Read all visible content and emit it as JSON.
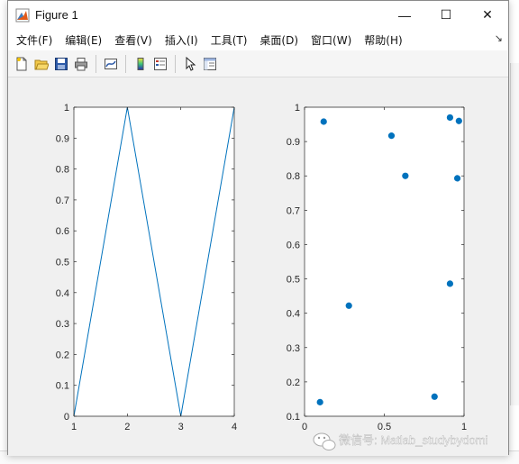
{
  "window": {
    "title": "Figure 1",
    "minimize_glyph": "—",
    "maximize_glyph": "☐",
    "close_glyph": "✕"
  },
  "menu": {
    "items": [
      {
        "label": "文件(F)"
      },
      {
        "label": "编辑(E)"
      },
      {
        "label": "查看(V)"
      },
      {
        "label": "插入(I)"
      },
      {
        "label": "工具(T)"
      },
      {
        "label": "桌面(D)"
      },
      {
        "label": "窗口(W)"
      },
      {
        "label": "帮助(H)"
      }
    ],
    "dock_glyph": "↘"
  },
  "toolbar": {
    "icons": [
      "new-figure-icon",
      "open-folder-icon",
      "save-icon",
      "print-icon",
      "link-plot-icon",
      "colorbar-icon",
      "legend-icon",
      "pointer-icon",
      "property-inspector-icon"
    ]
  },
  "watermark": {
    "text": "微信号: Matlab_studybydomi"
  },
  "chart_data": [
    {
      "type": "line",
      "x": [
        1,
        2,
        3,
        4
      ],
      "series": [
        {
          "values": [
            0,
            1,
            0,
            1
          ]
        }
      ],
      "xlim": [
        1,
        4
      ],
      "ylim": [
        0,
        1
      ],
      "xticks": [
        "1",
        "2",
        "3",
        "4"
      ],
      "yticks": [
        "0",
        "0.1",
        "0.2",
        "0.3",
        "0.4",
        "0.5",
        "0.6",
        "0.7",
        "0.8",
        "0.9",
        "1"
      ],
      "color": "#0072bd",
      "grid": false
    },
    {
      "type": "scatter",
      "points": [
        {
          "x": 0.12,
          "y": 0.958
        },
        {
          "x": 0.545,
          "y": 0.917
        },
        {
          "x": 0.912,
          "y": 0.97
        },
        {
          "x": 0.968,
          "y": 0.96
        },
        {
          "x": 0.632,
          "y": 0.8
        },
        {
          "x": 0.958,
          "y": 0.793
        },
        {
          "x": 0.912,
          "y": 0.486
        },
        {
          "x": 0.278,
          "y": 0.422
        },
        {
          "x": 0.097,
          "y": 0.141
        },
        {
          "x": 0.815,
          "y": 0.157
        }
      ],
      "xlim": [
        0,
        1
      ],
      "ylim": [
        0.1,
        1
      ],
      "xticks": [
        "0",
        "0.5",
        "1"
      ],
      "yticks": [
        "0.1",
        "0.2",
        "0.3",
        "0.4",
        "0.5",
        "0.6",
        "0.7",
        "0.8",
        "0.9",
        "1"
      ],
      "color": "#0072bd",
      "grid": false
    }
  ]
}
